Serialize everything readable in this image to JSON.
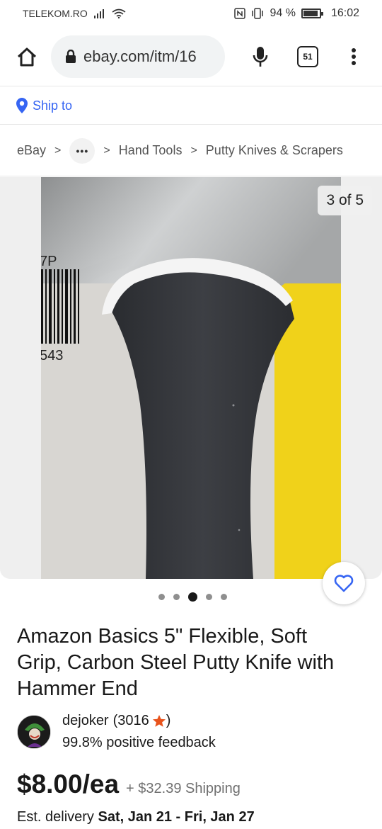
{
  "status_bar": {
    "carrier": "TELEKOM.RO",
    "battery": "94 %",
    "time": "16:02"
  },
  "browser": {
    "url": "ebay.com/itm/16",
    "tab_count": "51",
    "icons": [
      "home-icon",
      "lock-icon",
      "mic-icon",
      "tab-switcher-icon",
      "more-vert-icon"
    ]
  },
  "ship_to": {
    "label": "Ship to",
    "icon": "location-pin-icon",
    "color": "#3665f3"
  },
  "breadcrumb": {
    "items": [
      "eBay",
      "...",
      "Hand Tools",
      "Putty Knives & Scrapers"
    ]
  },
  "gallery": {
    "counter": "3 of 5",
    "current_index": 3,
    "total": 5,
    "photo_text": {
      "code_top": "7P",
      "code_bottom": "543"
    }
  },
  "listing": {
    "title": "Amazon Basics 5\" Flexible, Soft Grip, Carbon Steel Putty Knife with Hammer End",
    "seller": {
      "name": "dejoker",
      "feedback_count": "(3016",
      "feedback_close": ")",
      "star_color": "#e8531c",
      "positive": "99.8% positive feedback"
    },
    "price": "$8.00/ea",
    "shipping": "+ $32.39 Shipping",
    "delivery_label": "Est. delivery",
    "delivery_dates": "Sat, Jan 21 - Fri, Jan 27"
  }
}
